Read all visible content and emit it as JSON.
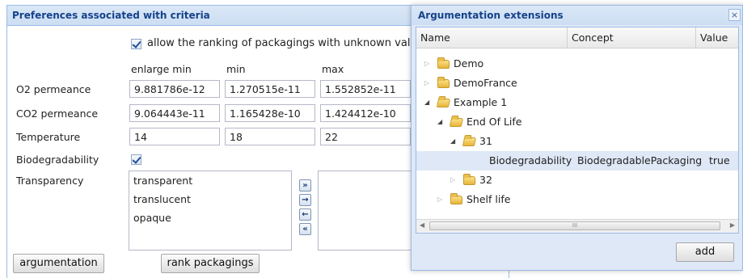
{
  "panel": {
    "title": "Preferences associated with criteria",
    "allow_label": "allow the ranking of packagings with unknown values for",
    "columns": {
      "enlarge_min": "enlarge min",
      "min": "min",
      "max": "max"
    },
    "rows": [
      {
        "label": "O2 permeance",
        "enlarge_min": "9.881786e-12",
        "min": "1.270515e-11",
        "max": "1.552852e-11"
      },
      {
        "label": "CO2 permeance",
        "enlarge_min": "9.064443e-11",
        "min": "1.165428e-10",
        "max": "1.424412e-10"
      },
      {
        "label": "Temperature",
        "enlarge_min": "14",
        "min": "18",
        "max": "22"
      }
    ],
    "biodegradability_label": "Biodegradability",
    "transparency_label": "Transparency",
    "transparency_options": [
      "transparent",
      "translucent",
      "opaque"
    ],
    "argumentation_button": "argumentation",
    "rank_button": "rank packagings"
  },
  "window": {
    "title": "Argumentation extensions",
    "close_glyph": "×",
    "headers": {
      "name": "Name",
      "concept": "Concept",
      "value": "Value"
    },
    "tree": {
      "demo": "Demo",
      "demofrance": "DemoFrance",
      "example1": "Example 1",
      "endoflife": "End Of Life",
      "n31": "31",
      "leaf_name": "Biodegradability",
      "leaf_concept": "BiodegradablePackaging",
      "leaf_value": "true",
      "n32": "32",
      "shelflife": "Shelf life"
    },
    "scroll_grip": "III",
    "add_button": "add"
  },
  "colors": {
    "header_text": "#15428b",
    "panel_border": "#99bbe8",
    "selected_row": "#dfe8f6",
    "folder": "#e8b53a"
  }
}
